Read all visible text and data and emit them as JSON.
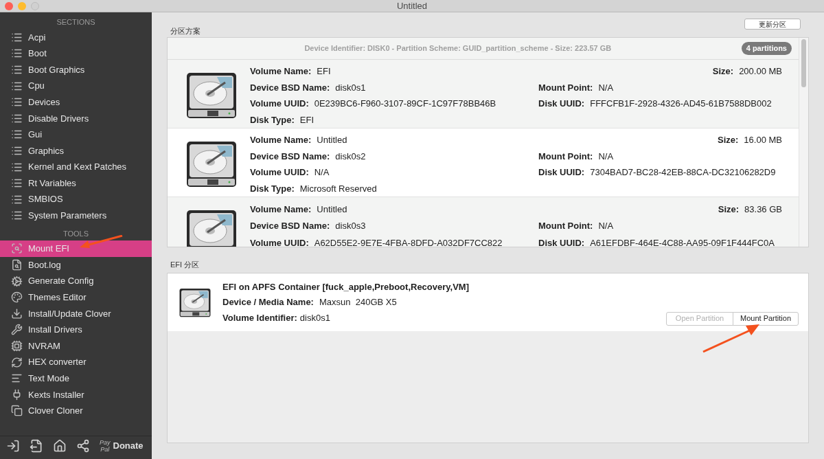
{
  "window": {
    "title": "Untitled"
  },
  "sidebar": {
    "sections_title": "SECTIONS",
    "sections": [
      {
        "label": "Acpi",
        "selected": false
      },
      {
        "label": "Boot",
        "selected": false
      },
      {
        "label": "Boot Graphics",
        "selected": false
      },
      {
        "label": "Cpu",
        "selected": false
      },
      {
        "label": "Devices",
        "selected": false
      },
      {
        "label": "Disable Drivers",
        "selected": false
      },
      {
        "label": "Gui",
        "selected": false
      },
      {
        "label": "Graphics",
        "selected": false
      },
      {
        "label": "Kernel and Kext Patches",
        "selected": false
      },
      {
        "label": "Rt Variables",
        "selected": false
      },
      {
        "label": "SMBIOS",
        "selected": false
      },
      {
        "label": "System Parameters",
        "selected": false
      }
    ],
    "tools_title": "TOOLS",
    "tools": [
      {
        "label": "Mount EFI",
        "kind": "mount",
        "selected": true
      },
      {
        "label": "Boot.log",
        "kind": "log",
        "selected": false
      },
      {
        "label": "Generate Config",
        "kind": "gears",
        "selected": false
      },
      {
        "label": "Themes Editor",
        "kind": "palette",
        "selected": false
      },
      {
        "label": "Install/Update Clover",
        "kind": "install",
        "selected": false
      },
      {
        "label": "Install Drivers",
        "kind": "tools",
        "selected": false
      },
      {
        "label": "NVRAM",
        "kind": "chip",
        "selected": false
      },
      {
        "label": "HEX converter",
        "kind": "convert",
        "selected": false
      },
      {
        "label": "Text Mode",
        "kind": "text",
        "selected": false
      },
      {
        "label": "Kexts Installer",
        "kind": "plug",
        "selected": false
      },
      {
        "label": "Clover Cloner",
        "kind": "clone",
        "selected": false
      }
    ],
    "footer": {
      "buttons": [
        {
          "kind": "import"
        },
        {
          "kind": "export"
        },
        {
          "kind": "home"
        },
        {
          "kind": "share"
        }
      ],
      "donate": {
        "logo_top": "Pay",
        "logo_bottom": "Pal",
        "label": "Donate"
      }
    }
  },
  "partitions": {
    "title": "分区方案",
    "refresh_button": "更新分区",
    "header": "Device Identifier: DISK0 - Partition Scheme: GUID_partition_scheme - Size: 223.57 GB",
    "count_badge": "4 partitions",
    "items": [
      {
        "lines": [
          {
            "left": {
              "label": "Volume Name:",
              "value": "EFI"
            },
            "right": {
              "kind": "end",
              "label": "Size:",
              "value": "200.00 MB"
            }
          },
          {
            "left": {
              "label": "Device BSD Name:",
              "value": "disk0s1"
            },
            "right": {
              "kind": "column",
              "label": "Mount Point:",
              "value": "N/A"
            }
          },
          {
            "left": {
              "label": "Volume UUID:",
              "value": "0E239BC6-F960-3107-89CF-1C97F78BB46B"
            },
            "right": {
              "kind": "column",
              "label": "Disk UUID:",
              "value": "FFFCFB1F-2928-4326-AD45-61B7588DB002"
            }
          },
          {
            "left": {
              "label": "Disk Type:",
              "value": "EFI"
            }
          }
        ]
      },
      {
        "lines": [
          {
            "left": {
              "label": "Volume Name:",
              "value": "Untitled"
            },
            "right": {
              "kind": "end",
              "label": "Size:",
              "value": "16.00 MB"
            }
          },
          {
            "left": {
              "label": "Device BSD Name:",
              "value": "disk0s2"
            },
            "right": {
              "kind": "column",
              "label": "Mount Point:",
              "value": "N/A"
            }
          },
          {
            "left": {
              "label": "Volume UUID:",
              "value": "N/A"
            },
            "right": {
              "kind": "column",
              "label": "Disk UUID:",
              "value": "7304BAD7-BC28-42EB-88CA-DC32106282D9"
            }
          },
          {
            "left": {
              "label": "Disk Type:",
              "value": "Microsoft Reserved"
            }
          }
        ]
      },
      {
        "lines": [
          {
            "left": {
              "label": "Volume Name:",
              "value": "Untitled"
            },
            "right": {
              "kind": "end",
              "label": "Size:",
              "value": "83.36 GB"
            }
          },
          {
            "left": {
              "label": "Device BSD Name:",
              "value": "disk0s3"
            },
            "right": {
              "kind": "column",
              "label": "Mount Point:",
              "value": "N/A"
            }
          },
          {
            "left": {
              "label": "Volume UUID:",
              "value": "A62D55E2-9E7E-4FBA-8DFD-A032DF7CC822"
            },
            "right": {
              "kind": "column",
              "label": "Disk UUID:",
              "value": "A61EFDBF-464E-4C88-AA95-09F1F444FC0A"
            }
          }
        ]
      }
    ]
  },
  "efi": {
    "title": "EFI 分区",
    "name": "EFI on APFS Container [fuck_apple,Preboot,Recovery,VM]",
    "media_label": "Device / Media Name:",
    "media_value": "Maxsun  240GB X5",
    "id_label": "Volume Identifier:",
    "id_value": "disk0s1",
    "buttons": [
      {
        "label": "Open Partition",
        "disabled": true
      },
      {
        "label": "Mount Partition",
        "disabled": false
      }
    ]
  }
}
